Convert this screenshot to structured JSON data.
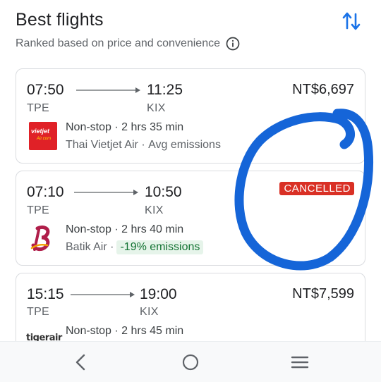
{
  "header": {
    "title": "Best flights",
    "subtitle": "Ranked based on price and convenience"
  },
  "flights": [
    {
      "depart_time": "07:50",
      "arrive_time": "11:25",
      "from": "TPE",
      "to": "KIX",
      "price": "NT$6,697",
      "stops": "Non-stop",
      "duration": "2 hrs 35 min",
      "airline": "Thai Vietjet Air",
      "emissions": "Avg emissions",
      "logo_text": "vietjet"
    },
    {
      "depart_time": "07:10",
      "arrive_time": "10:50",
      "from": "TPE",
      "to": "KIX",
      "status": "CANCELLED",
      "stops": "Non-stop",
      "duration": "2 hrs 40 min",
      "airline": "Batik Air",
      "emissions": "-19% emissions"
    },
    {
      "depart_time": "15:15",
      "arrive_time": "19:00",
      "from": "TPE",
      "to": "KIX",
      "price": "NT$7,599",
      "stops": "Non-stop",
      "duration": "2 hrs 45 min",
      "logo_text": "tigerair"
    }
  ],
  "colors": {
    "accent": "#1a73e8",
    "cancel": "#d93025",
    "emissions_bg": "#e6f4ea",
    "emissions_fg": "#137333",
    "annotation": "#1565d8"
  },
  "icons": {
    "sort": "swap-vertical-icon",
    "info": "info-icon",
    "nav_back": "back-icon",
    "nav_home": "home-icon",
    "nav_menu": "recents-icon"
  }
}
